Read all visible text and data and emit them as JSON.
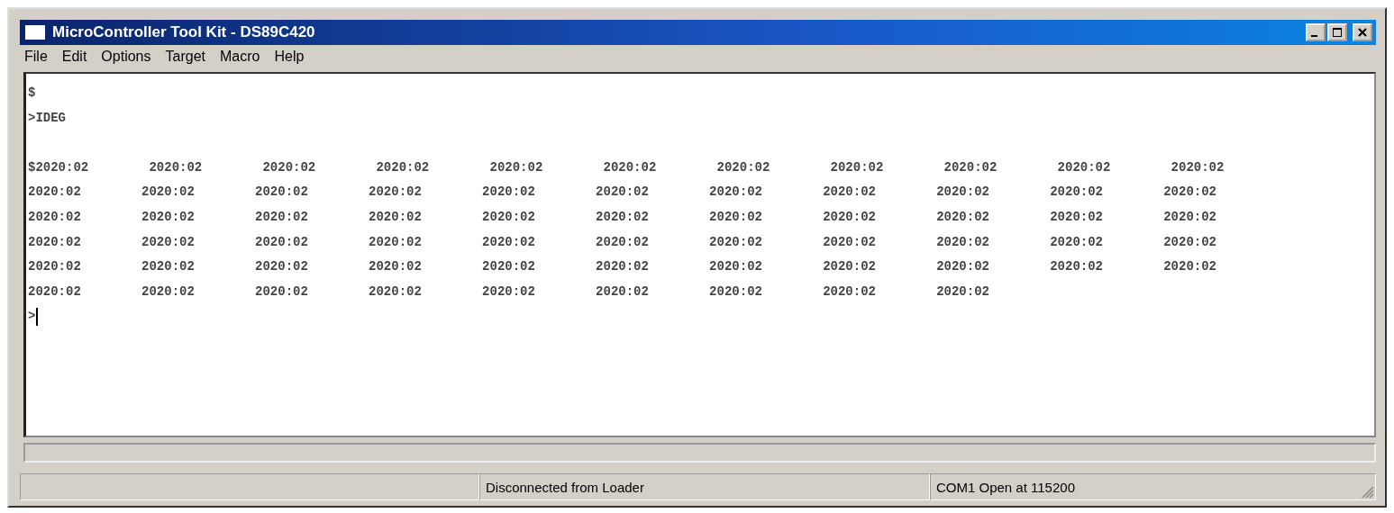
{
  "window": {
    "title": "MicroController Tool Kit - DS89C420"
  },
  "menu": [
    "File",
    "Edit",
    "Options",
    "Target",
    "Macro",
    "Help"
  ],
  "terminal": {
    "lines": [
      "$",
      ">IDEG"
    ],
    "output": [
      "$2020:02        2020:02        2020:02        2020:02        2020:02        2020:02        2020:02        2020:02        2020:02        2020:02        2020:02",
      "2020:02        2020:02        2020:02        2020:02        2020:02        2020:02        2020:02        2020:02        2020:02        2020:02        2020:02",
      "2020:02        2020:02        2020:02        2020:02        2020:02        2020:02        2020:02        2020:02        2020:02        2020:02        2020:02",
      "2020:02        2020:02        2020:02        2020:02        2020:02        2020:02        2020:02        2020:02        2020:02        2020:02        2020:02",
      "2020:02        2020:02        2020:02        2020:02        2020:02        2020:02        2020:02        2020:02        2020:02        2020:02        2020:02",
      "2020:02        2020:02        2020:02        2020:02        2020:02        2020:02        2020:02        2020:02        2020:02"
    ],
    "prompt": ">"
  },
  "status_bar": {
    "connection": "Disconnected from Loader",
    "port": "COM1 Open at 115200"
  }
}
